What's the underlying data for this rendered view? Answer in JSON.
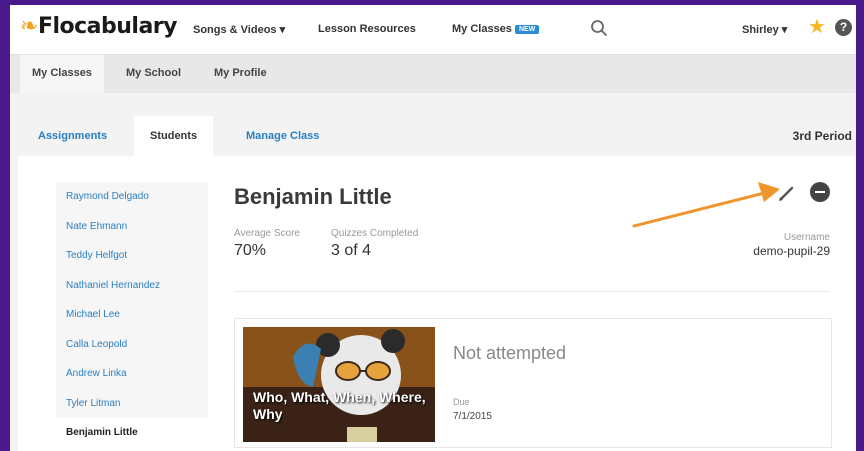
{
  "header": {
    "logo": "Flocabulary",
    "nav": [
      {
        "label": "Songs & Videos"
      },
      {
        "label": "Lesson Resources"
      },
      {
        "label": "My Classes",
        "badge": "NEW"
      }
    ],
    "user_name": "Shirley",
    "help": "?"
  },
  "subnav": {
    "tabs": [
      {
        "label": "My Classes"
      },
      {
        "label": "My School"
      },
      {
        "label": "My Profile"
      }
    ]
  },
  "class_tabs": {
    "tabs": [
      {
        "label": "Assignments"
      },
      {
        "label": "Students"
      },
      {
        "label": "Manage Class"
      }
    ],
    "period": "3rd Period"
  },
  "roster": {
    "students": [
      "Raymond Delgado",
      "Nate Ehmann",
      "Teddy Helfgot",
      "Nathaniel Hernandez",
      "Michael Lee",
      "Calla Leopold",
      "Andrew Linka",
      "Tyler Litman",
      "Benjamin Little"
    ]
  },
  "student_detail": {
    "name": "Benjamin Little",
    "average_score_label": "Average Score",
    "average_score": "70%",
    "quizzes_label": "Quizzes Completed",
    "quizzes": "3 of 4",
    "username_label": "Username",
    "username": "demo-pupil-29"
  },
  "assignment": {
    "title": "Who, What, When, Where, Why",
    "status": "Not attempted",
    "due_label": "Due",
    "due_date": "7/1/2015"
  },
  "colors": {
    "brand_purple": "#4a1a8c",
    "link_blue": "#2a7fc1",
    "arrow_orange": "#f0952c",
    "star_gold": "#f5b820"
  }
}
